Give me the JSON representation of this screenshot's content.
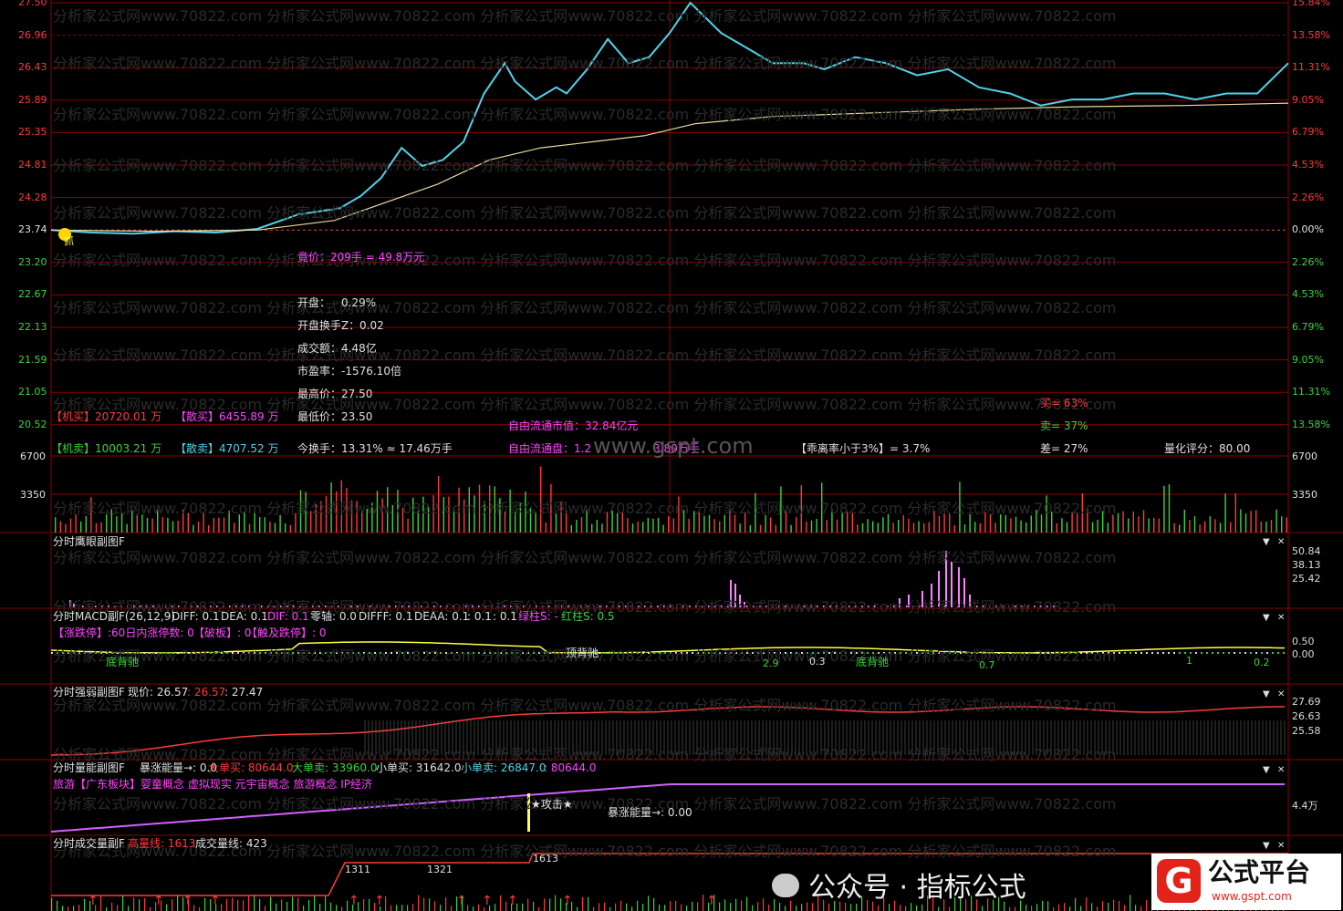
{
  "colors": {
    "grid": "#8b0000",
    "price_line": "#4fd3e8",
    "avg_line": "#e8d9a0",
    "red": "#ff3a3a",
    "green": "#3ad43a",
    "magenta": "#ff44ff",
    "yellow": "#ffff44",
    "white": "#e0e0e0",
    "pink": "#ff80ff",
    "bg": "#000000"
  },
  "watermark": "分析家公式网www.70822.com 分析家公式网www.70822.com 分析家公式网www.70822.com 分析家公式网www.70822.com 分析家公式网www.70822.com",
  "main": {
    "price_labels": [
      {
        "v": "27.50",
        "c": "red"
      },
      {
        "v": "26.96",
        "c": "red"
      },
      {
        "v": "26.43",
        "c": "red"
      },
      {
        "v": "25.89",
        "c": "red"
      },
      {
        "v": "25.35",
        "c": "red"
      },
      {
        "v": "24.81",
        "c": "red"
      },
      {
        "v": "24.28",
        "c": "red"
      },
      {
        "v": "23.74",
        "c": "white"
      },
      {
        "v": "23.20",
        "c": "green"
      },
      {
        "v": "22.67",
        "c": "green"
      },
      {
        "v": "22.13",
        "c": "green"
      },
      {
        "v": "21.59",
        "c": "green"
      },
      {
        "v": "21.05",
        "c": "green"
      },
      {
        "v": "20.52",
        "c": "green"
      }
    ],
    "pct_labels": [
      {
        "v": "15.84%",
        "c": "red"
      },
      {
        "v": "13.58%",
        "c": "red"
      },
      {
        "v": "11.31%",
        "c": "red"
      },
      {
        "v": "9.05%",
        "c": "red"
      },
      {
        "v": "6.79%",
        "c": "red"
      },
      {
        "v": "4.53%",
        "c": "red"
      },
      {
        "v": "2.26%",
        "c": "red"
      },
      {
        "v": "0.00%",
        "c": "white"
      },
      {
        "v": "2.26%",
        "c": "green"
      },
      {
        "v": "4.53%",
        "c": "green"
      },
      {
        "v": "6.79%",
        "c": "green"
      },
      {
        "v": "9.05%",
        "c": "green"
      },
      {
        "v": "11.31%",
        "c": "green"
      },
      {
        "v": "13.58%",
        "c": "green"
      }
    ],
    "marker_text": "抓",
    "info": {
      "auction": "竟价：209手 = 49.8万元",
      "rows": [
        {
          "k": "开盘：",
          "v": "0.29%"
        },
        {
          "k": "开盘换手Z：",
          "v": "0.02"
        },
        {
          "k": "成交额：",
          "v": "4.48亿"
        },
        {
          "k": "市盈率：",
          "v": "-1576.10倍"
        },
        {
          "k": "最高价：",
          "v": "27.50"
        },
        {
          "k": "最低价：",
          "v": "23.50"
        }
      ],
      "turnover": "今换手：13.31% ≈ 17.46万手",
      "float_cap": "自由流通市值：32.84亿元",
      "float_share": "自由流通盘：1.2",
      "float_share_tail": "3.80万手",
      "inst_buy_k": "【机买】",
      "inst_buy_v": "20720.01 万",
      "retail_buy_k": "【散买】",
      "retail_buy_v": "6455.89 万",
      "inst_sell_k": "【机卖】",
      "inst_sell_v": "10003.21 万",
      "retail_sell_k": "【散卖】",
      "retail_sell_v": "4707.52 万",
      "deviation": "【乖离率小于3%】= 3.7%",
      "buy": "买= 63%",
      "sell": "卖= 37%",
      "diff": "差= 27%",
      "score": "量化评分：80.00",
      "site": "www.gspt.com"
    }
  },
  "chart_data": [
    {
      "type": "line",
      "title": "分时走势",
      "x_range": [
        0,
        240
      ],
      "ylim": [
        20.52,
        27.5
      ],
      "base": 23.74,
      "series": [
        {
          "name": "",
          "color": "#4fd3e8",
          "x": [
            0,
            8,
            16,
            24,
            32,
            40,
            48,
            56,
            60,
            64,
            68,
            72,
            76,
            80,
            84,
            88,
            90,
            94,
            98,
            100,
            104,
            108,
            112,
            116,
            120,
            124,
            130,
            136,
            140,
            146,
            150,
            156,
            162,
            168,
            174,
            180,
            186,
            192,
            198,
            204,
            210,
            216,
            222,
            228,
            234,
            240
          ],
          "y": [
            23.74,
            23.7,
            23.68,
            23.72,
            23.7,
            23.76,
            24.0,
            24.1,
            24.3,
            24.6,
            25.1,
            24.8,
            24.9,
            25.2,
            26.0,
            26.5,
            26.2,
            25.9,
            26.1,
            26.0,
            26.4,
            26.9,
            26.5,
            26.6,
            27.0,
            27.5,
            27.0,
            26.7,
            26.5,
            26.5,
            26.4,
            26.6,
            26.5,
            26.3,
            26.4,
            26.1,
            26.0,
            25.8,
            25.9,
            25.9,
            26.0,
            26.0,
            25.9,
            26.0,
            26.0,
            26.5
          ]
        },
        {
          "name": "",
          "color": "#e8d9a0",
          "x": [
            0,
            20,
            40,
            55,
            65,
            75,
            85,
            95,
            105,
            115,
            125,
            140,
            160,
            180,
            200,
            220,
            240
          ],
          "y": [
            23.74,
            23.72,
            23.74,
            23.9,
            24.2,
            24.5,
            24.9,
            25.1,
            25.2,
            25.3,
            25.5,
            25.62,
            25.68,
            25.74,
            25.78,
            25.8,
            25.84
          ]
        }
      ]
    },
    {
      "type": "bar",
      "title": "成交量",
      "ylim": [
        0,
        6700
      ],
      "ticks": [
        "6700",
        "3350"
      ]
    },
    {
      "type": "bar",
      "title": "分时鹰眼副图F",
      "ticks": [
        "50.84",
        "38.13",
        "25.42"
      ]
    },
    {
      "type": "line",
      "title": "分时MACD副F(26,12,9)",
      "ticks": [
        "0.50",
        "0.00"
      ]
    },
    {
      "type": "line",
      "title": "分时强弱副图F",
      "ticks": [
        "27.69",
        "26.63",
        "25.58"
      ]
    },
    {
      "type": "area",
      "title": "分时量能副图F",
      "ticks": [
        "4.4万"
      ]
    },
    {
      "type": "bar",
      "title": "分时成交量副F",
      "labels": [
        "1311",
        "1321",
        "1613"
      ]
    }
  ],
  "vol": {
    "ticks": [
      "6700",
      "3350"
    ],
    "ticks_right": [
      "6700",
      "3350"
    ]
  },
  "eagle": {
    "title": "分时鹰眼副图F",
    "ticks": [
      "50.84",
      "38.13",
      "25.42"
    ]
  },
  "macd": {
    "title": "分时MACD副F(26,12,9)",
    "diff": "DIFF: 0.1",
    "dea": "DEA: 0.1",
    "dif2": "DIF: 0.1",
    "zero": "零轴: 0.0",
    "difff": "DIFFF: 0.1",
    "deaa": "DEAA: 0.1",
    "c1": ": 0.1",
    "c2": ": 0.1",
    "green_bar": "绿柱S: -",
    "red_bar": "红柱S: 0.5",
    "line2_a": "【涨跌停】:60日内涨停数: 0",
    "line2_b": "【破板】: 0",
    "line2_c": "【触及跌停】: 0",
    "ann_a": "底背驰",
    "ann_b": "顶背驰",
    "ann_c": "底背驰",
    "v1": "2.9",
    "v2": "0.3",
    "v3": "0.7",
    "v4": "1",
    "v5": "0.2",
    "ticks": [
      "0.50",
      "0.00"
    ]
  },
  "strength": {
    "title": "分时强弱副图F",
    "now": "现价: 26.57",
    "v2": ": 26.57",
    "v3": ": 27.47",
    "ticks": [
      "27.69",
      "26.63",
      "25.58"
    ]
  },
  "energy": {
    "title": "分时量能副图F",
    "surge": "暴涨能量→: 0.0",
    "big_buy": "大单买: 80644.0",
    "big_sell": "大单卖: 33960.0",
    "small_buy": "小单买: 31642.0",
    "small_sell": "小单卖: 26847.0",
    "tail": ": 80644.0",
    "concepts": "旅游【广东板块】婴童概念 虚拟现实 元宇宙概念 旅游概念 IP经济",
    "attack": "★攻击★",
    "surge2": "暴涨能量→: 0.00",
    "tick": "4.4万"
  },
  "tradevol": {
    "title": "分时成交量副F",
    "high": "高量线: 1613",
    "vol": "成交量线: 423",
    "l1": "1311",
    "l2": "1321",
    "l3": "1613"
  },
  "footer": {
    "wechat": "公众号 · 指标公式",
    "brand": "公式平台",
    "brand_url": "www.gspt.com"
  }
}
